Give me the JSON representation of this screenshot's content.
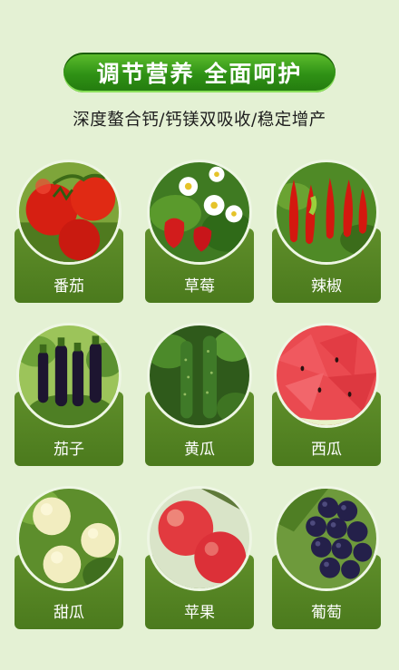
{
  "banner": {
    "text": "调节营养 全面呵护"
  },
  "subtitle": "深度螯合钙/钙镁双吸收/稳定增产",
  "crops": [
    {
      "label": "番茄",
      "icon": "tomato-photo"
    },
    {
      "label": "草莓",
      "icon": "strawberry-photo"
    },
    {
      "label": "辣椒",
      "icon": "chili-photo"
    },
    {
      "label": "茄子",
      "icon": "eggplant-photo"
    },
    {
      "label": "黄瓜",
      "icon": "cucumber-photo"
    },
    {
      "label": "西瓜",
      "icon": "watermelon-photo"
    },
    {
      "label": "甜瓜",
      "icon": "melon-photo"
    },
    {
      "label": "苹果",
      "icon": "apple-photo"
    },
    {
      "label": "葡萄",
      "icon": "grape-photo"
    }
  ],
  "colors": {
    "background": "#e4f1d4",
    "banner": "#2f9115",
    "card": "#557f24"
  }
}
